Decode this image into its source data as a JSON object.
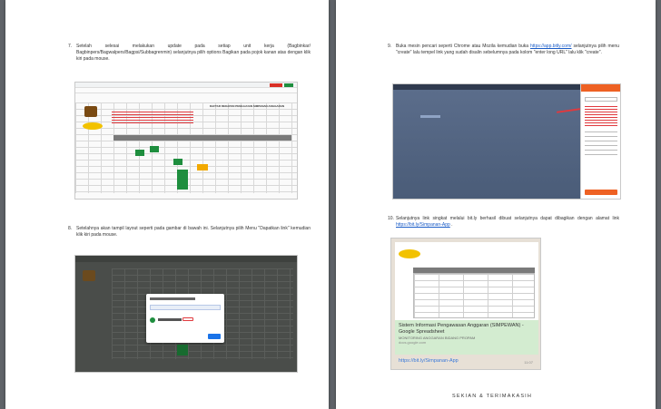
{
  "document": {
    "step7": {
      "number": "7.",
      "text": "Setelah selesai melakukan update pada setiap unit kerja (Bagbinkar/ Bagbinpers/Bagwalpers/Bagpsi/Subbagrenmin) selanjutnya pilih options Bagikan pada pojok kanan atas dengan klik kiri pada mouse."
    },
    "step8": {
      "number": "8.",
      "text": "Setelahnya akan tampil layout seperti pada gambar di bawah ini. Selanjutnya pilih Menu \"Dapatkan link\" kemudian klik kiri pada mouse."
    },
    "step9": {
      "number": "9.",
      "text_before": "Buka mesin pencari seperti Chrome atau Mozila kemudian buka",
      "link": "https://app.bitly.com/",
      "text_after": "selanjutnya pilih menu \"create\" lalu tempel link yang sudah disalin sebelumnya pada kolom \"enter long URL\" lalu klik \"create\"."
    },
    "step10": {
      "number": "10.",
      "text_before": "Selanjutnya link singkat melalui bit.ly berhasil dibuat selanjutnya dapat dibagikan dengan alamat link",
      "link": "https://bit.ly/Simpanan-App",
      "text_after": "."
    },
    "sheet_header": "DAFTAR REKAPAN PENGAJUAN SIMPANAN ANGGARAN",
    "whatsapp_card": {
      "title": "Sistem Informasi Pengawasan Anggaran (SIMPEWAN) - Google Spreadsheet",
      "subtitle": "MONITORING ANGGARAN BIDANG PROPAM",
      "domain": "docs.google.com",
      "link": "https://bit.ly/Simpanan-App",
      "time": "11:07"
    },
    "footer": "SEKIAN & TERIMAKASIH"
  }
}
